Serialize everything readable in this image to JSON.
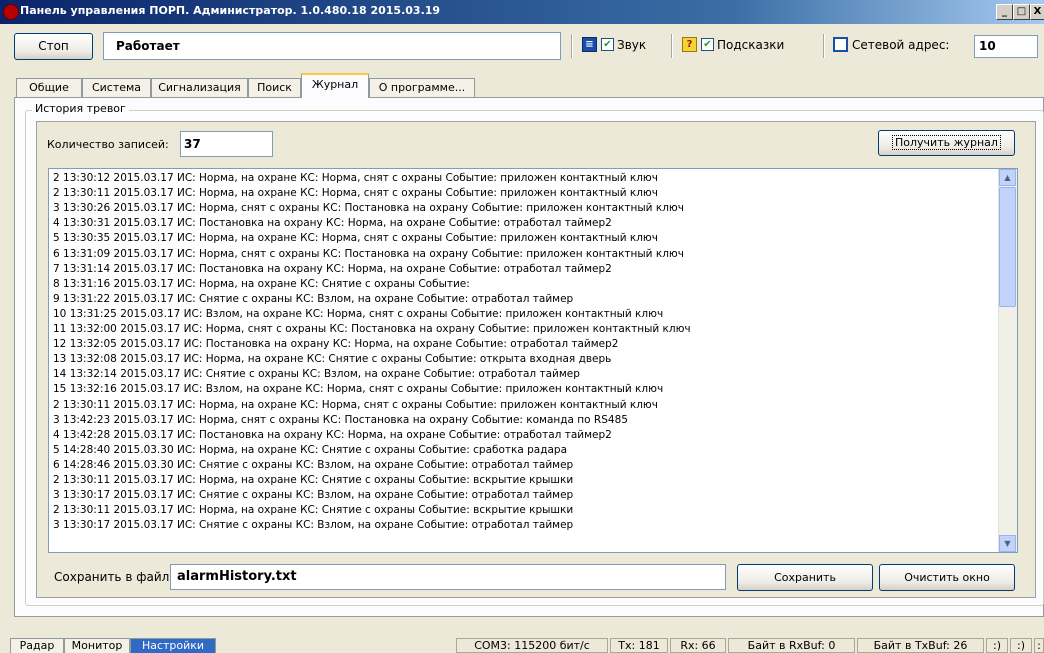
{
  "window": {
    "title": "Панель управления ПОРП. Администратор. 1.0.480.18 2015.03.19",
    "minimize": "_",
    "maximize": "□",
    "close": "X"
  },
  "toolbar": {
    "stop_label": "Стоп",
    "status_text": "Работает",
    "sound_label": "Звук",
    "sound_checked": true,
    "hints_label": "Подсказки",
    "hints_checked": true,
    "network_address_label": "Сетевой адрес:",
    "network_address_value": "10"
  },
  "tabs": [
    {
      "label": "Общие"
    },
    {
      "label": "Система"
    },
    {
      "label": "Сигнализация"
    },
    {
      "label": "Поиск"
    },
    {
      "label": "Журнал",
      "active": true
    },
    {
      "label": "О программе..."
    }
  ],
  "journal": {
    "group_title": "История тревог",
    "count_label": "Количество записей:",
    "count_value": "37",
    "get_log_button": "Получить журнал",
    "save_to_file_label": "Сохранить в файл:",
    "file_name": "alarmHistory.txt",
    "save_button": "Сохранить",
    "clear_button": "Очистить окно",
    "log_lines": [
      "2 13:30:12 2015.03.17  ИС: Норма, на охране  КС: Норма, снят с охраны  Событие:  приложен контактный ключ",
      "2 13:30:11 2015.03.17  ИС: Норма, на охране  КС: Норма, снят с охраны  Событие:  приложен контактный ключ",
      "3 13:30:26 2015.03.17  ИС: Норма, снят с охраны  КС: Постановка на охрану  Событие:  приложен контактный ключ",
      "4 13:30:31 2015.03.17  ИС: Постановка на охрану  КС: Норма, на охране  Событие:  отработал таймер2",
      "5 13:30:35 2015.03.17  ИС: Норма, на охране  КС: Норма, снят с охраны  Событие:  приложен контактный ключ",
      "6 13:31:09 2015.03.17  ИС: Норма, снят с охраны  КС: Постановка на охрану  Событие:  приложен контактный ключ",
      "7 13:31:14 2015.03.17  ИС: Постановка на охрану  КС: Норма, на охране  Событие:  отработал таймер2",
      "8 13:31:16 2015.03.17  ИС: Норма, на охране  КС: Снятие с охраны  Событие:",
      "9 13:31:22 2015.03.17  ИС: Снятие с охраны  КС: Взлом, на охране  Событие:  отработал таймер",
      "10 13:31:25 2015.03.17  ИС: Взлом, на охране  КС: Норма, снят с охраны  Событие:  приложен контактный ключ",
      "11 13:32:00 2015.03.17  ИС: Норма, снят с охраны  КС: Постановка на охрану  Событие:  приложен контактный ключ",
      "12 13:32:05 2015.03.17  ИС: Постановка на охрану  КС: Норма, на охране  Событие:  отработал таймер2",
      "13 13:32:08 2015.03.17  ИС: Норма, на охране  КС: Снятие с охраны  Событие:  открыта входная дверь",
      "14 13:32:14 2015.03.17  ИС: Снятие с охраны  КС: Взлом, на охране  Событие:  отработал таймер",
      "15 13:32:16 2015.03.17  ИС: Взлом, на охране  КС: Норма, снят с охраны  Событие:  приложен контактный ключ",
      "2 13:30:11 2015.03.17  ИС: Норма, на охране  КС: Норма, снят с охраны  Событие:  приложен контактный ключ",
      "3 13:42:23 2015.03.17  ИС: Норма, снят с охраны  КС: Постановка на охрану  Событие:  команда по RS485",
      "4 13:42:28 2015.03.17  ИС: Постановка на охрану  КС: Норма, на охране  Событие:  отработал таймер2",
      "5 14:28:40 2015.03.30  ИС: Норма, на охране  КС: Снятие с охраны  Событие:  сработка радара",
      "6 14:28:46 2015.03.30  ИС: Снятие с охраны  КС: Взлом, на охране  Событие:  отработал таймер",
      "2 13:30:11 2015.03.17  ИС: Норма, на охране  КС: Снятие с охраны  Событие:  вскрытие крышки",
      "3 13:30:17 2015.03.17  ИС: Снятие с охраны  КС: Взлом, на охране  Событие:  отработал таймер",
      "2 13:30:11 2015.03.17  ИС: Норма, на охране  КС: Снятие с охраны  Событие:  вскрытие крышки",
      "3 13:30:17 2015.03.17  ИС: Снятие с охраны  КС: Взлом, на охране  Событие:  отработал таймер"
    ]
  },
  "bottom_tabs": [
    {
      "label": "Радар"
    },
    {
      "label": "Монитор"
    },
    {
      "label": "Настройки",
      "active": true
    }
  ],
  "statusbar": {
    "port": "COM3: 115200 бит/с",
    "tx": "Tx: 181",
    "rx": "Rx: 66",
    "rxbuf": "Байт в RxBuf: 0",
    "txbuf": "Байт в TxBuf: 26",
    "ind1": ":)",
    "ind2": ":)",
    "ind3": ":"
  }
}
